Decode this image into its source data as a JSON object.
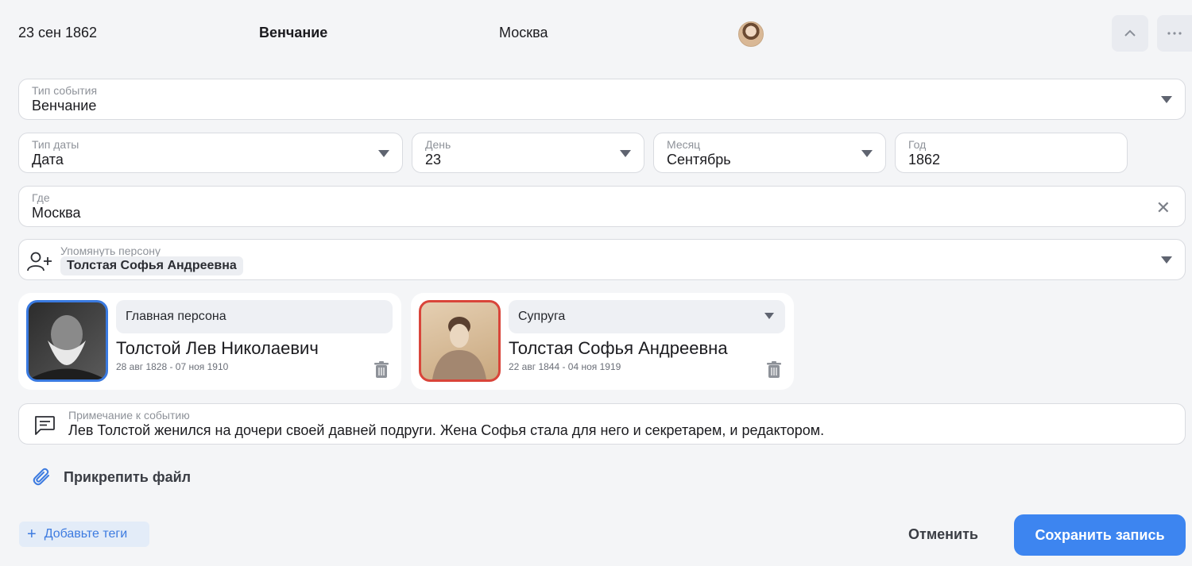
{
  "header": {
    "date": "23 сен 1862",
    "event_type": "Венчание",
    "place": "Москва",
    "collapse_icon": "chevron-up-icon",
    "more_icon": "more-horizontal-icon"
  },
  "event_type_field": {
    "label": "Тип события",
    "value": "Венчание"
  },
  "date_type_field": {
    "label": "Тип даты",
    "value": "Дата"
  },
  "day_field": {
    "label": "День",
    "value": "23"
  },
  "month_field": {
    "label": "Месяц",
    "value": "Сентябрь"
  },
  "year_field": {
    "label": "Год",
    "value": "1862"
  },
  "place_field": {
    "label": "Где",
    "value": "Москва"
  },
  "mention_field": {
    "label": "Упомянуть персону",
    "chip": "Толстая Софья Андреевна"
  },
  "persons": [
    {
      "role": "Главная персона",
      "name": "Толстой Лев Николаевич",
      "dates": "28 авг 1828 - 07 ноя 1910"
    },
    {
      "role": "Супруга",
      "name": "Толстая Софья Андреевна",
      "dates": "22 авг 1844 - 04 ноя 1919"
    }
  ],
  "note": {
    "label": "Примечание к событию",
    "value": "Лев Толстой женился на дочери своей давней подруги. Жена Софья стала для него и секретарем, и редактором."
  },
  "attach_label": "Прикрепить файл",
  "tags_label": "Добавьте теги",
  "cancel_label": "Отменить",
  "save_label": "Сохранить запись",
  "colors": {
    "accent": "#3d85f0",
    "main_person_border": "#3a7ae0",
    "spouse_border": "#d9453a"
  }
}
